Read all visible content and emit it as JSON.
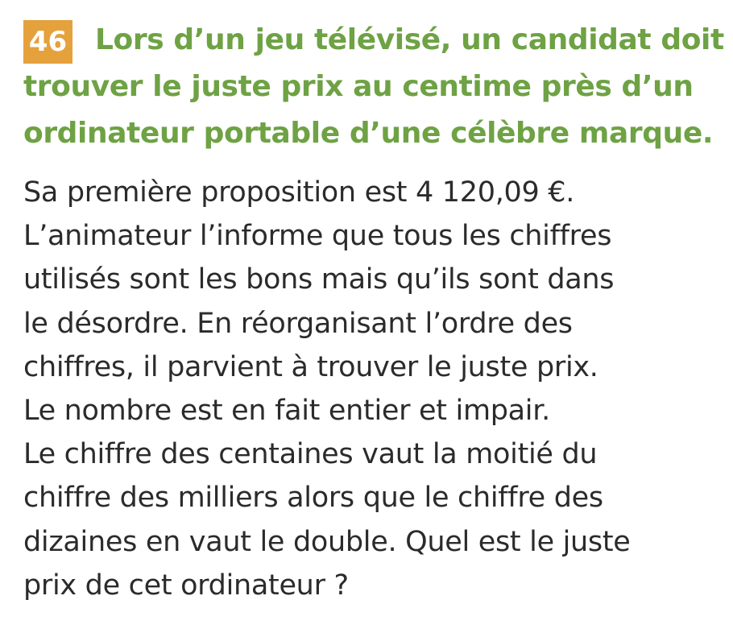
{
  "exercise": {
    "number": "46",
    "title_lines": [
      "Lors d’un jeu télévisé, un candidat doit",
      "trouver le juste prix au centime près d’un",
      "ordinateur portable d’une célèbre marque."
    ],
    "body_lines": [
      "Sa première proposition est 4 120,09 €.",
      "L’animateur l’informe que tous les chiffres",
      "utilisés sont les bons mais qu’ils sont dans",
      "le désordre. En réorganisant l’ordre des",
      "chiffres, il parvient à trouver le juste prix.",
      "Le nombre est en fait entier et impair.",
      "Le chiffre des centaines vaut la moitié du",
      "chiffre des milliers alors que le chiffre des",
      "dizaines en vaut le double. Quel est le juste",
      "prix de cet ordinateur ?"
    ]
  },
  "colors": {
    "badge": "#e5a13b",
    "title": "#6ea244",
    "body": "#2b2b2b"
  }
}
